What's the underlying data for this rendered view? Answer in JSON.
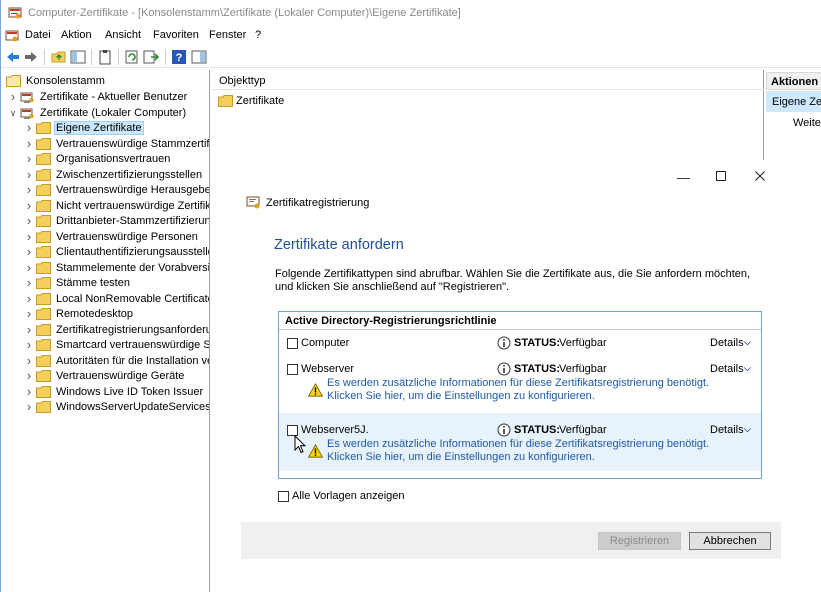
{
  "window": {
    "title": "Computer-Zertifikate - [Konsolenstamm\\Zertifikate (Lokaler Computer)\\Eigene Zertifikate]"
  },
  "menu": [
    "Datei",
    "Aktion",
    "Ansicht",
    "Favoriten",
    "Fenster",
    "?"
  ],
  "tree": {
    "root": "Konsolenstamm",
    "items": [
      {
        "label": "Zertifikate - Aktueller Benutzer",
        "level": 1,
        "expander": "collapsed",
        "icon": "cert-store-icon"
      },
      {
        "label": "Zertifikate (Lokaler Computer)",
        "level": 1,
        "expander": "expanded",
        "icon": "cert-store-icon"
      },
      {
        "label": "Eigene Zertifikate",
        "level": 2,
        "expander": "collapsed",
        "icon": "folder-icon",
        "selected": true
      },
      {
        "label": "Vertrauenswürdige Stammzertifi",
        "level": 2,
        "expander": "collapsed",
        "icon": "folder-icon"
      },
      {
        "label": "Organisationsvertrauen",
        "level": 2,
        "expander": "collapsed",
        "icon": "folder-icon"
      },
      {
        "label": "Zwischenzertifizierungsstellen",
        "level": 2,
        "expander": "collapsed",
        "icon": "folder-icon"
      },
      {
        "label": "Vertrauenswürdige Herausgeber",
        "level": 2,
        "expander": "collapsed",
        "icon": "folder-icon"
      },
      {
        "label": "Nicht vertrauenswürdige Zertifika",
        "level": 2,
        "expander": "collapsed",
        "icon": "folder-icon"
      },
      {
        "label": "Drittanbieter-Stammzertifizierung",
        "level": 2,
        "expander": "collapsed",
        "icon": "folder-icon"
      },
      {
        "label": "Vertrauenswürdige Personen",
        "level": 2,
        "expander": "collapsed",
        "icon": "folder-icon"
      },
      {
        "label": "Clientauthentifizierungsausstelle",
        "level": 2,
        "expander": "collapsed",
        "icon": "folder-icon"
      },
      {
        "label": "Stammelemente der Vorabversion",
        "level": 2,
        "expander": "collapsed",
        "icon": "folder-icon"
      },
      {
        "label": "Stämme testen",
        "level": 2,
        "expander": "collapsed",
        "icon": "folder-icon"
      },
      {
        "label": "Local NonRemovable Certificates",
        "level": 2,
        "expander": "collapsed",
        "icon": "folder-icon"
      },
      {
        "label": "Remotedesktop",
        "level": 2,
        "expander": "collapsed",
        "icon": "folder-icon"
      },
      {
        "label": "Zertifikatregistrierungsanforderur",
        "level": 2,
        "expander": "collapsed",
        "icon": "folder-icon"
      },
      {
        "label": "Smartcard vertrauenswürdige Stä",
        "level": 2,
        "expander": "collapsed",
        "icon": "folder-icon"
      },
      {
        "label": "Autoritäten für die Installation ve",
        "level": 2,
        "expander": "collapsed",
        "icon": "folder-icon"
      },
      {
        "label": "Vertrauenswürdige Geräte",
        "level": 2,
        "expander": "collapsed",
        "icon": "folder-icon"
      },
      {
        "label": "Windows Live ID Token Issuer",
        "level": 2,
        "expander": "collapsed",
        "icon": "folder-icon"
      },
      {
        "label": "WindowsServerUpdateServices",
        "level": 2,
        "expander": "collapsed",
        "icon": "folder-icon"
      }
    ]
  },
  "middle": {
    "column_header": "Objekttyp",
    "rows": [
      "Zertifikate"
    ]
  },
  "actions": {
    "header": "Aktionen",
    "selected": "Eigene Zerti",
    "sub": "Weiter"
  },
  "dialog": {
    "header": "Zertifikatregistrierung",
    "title": "Zertifikate anfordern",
    "description": "Folgende Zertifikattypen sind abrufbar. Wählen Sie die Zertifikate aus, die Sie anfordern möchten, und klicken Sie anschließend auf \"Registrieren\".",
    "policy_header": "Active Directory-Registrierungsrichtlinie",
    "status_label": "STATUS:",
    "details_label": "Details",
    "templates": [
      {
        "name": "Computer",
        "status": "Verfügbar",
        "warning": ""
      },
      {
        "name": "Webserver",
        "status": "Verfügbar",
        "warning": "Es werden zusätzliche Informationen für diese Zertifikatsregistrierung benötigt. Klicken Sie hier, um die Einstellungen zu konfigurieren."
      },
      {
        "name": "Webserver5J.",
        "status": "Verfügbar",
        "warning": "Es werden zusätzliche Informationen für diese Zertifikatsregistrierung benötigt. Klicken Sie hier, um die Einstellungen zu konfigurieren."
      }
    ],
    "show_all_label": "Alle Vorlagen anzeigen",
    "register_button": "Registrieren",
    "cancel_button": "Abbrechen"
  },
  "colors": {
    "accent": "#1f4e9a",
    "link": "#1f5aa8",
    "selection": "#cce8ff",
    "policy_border": "#6aa3d8",
    "folder": "#f3cf5c"
  }
}
